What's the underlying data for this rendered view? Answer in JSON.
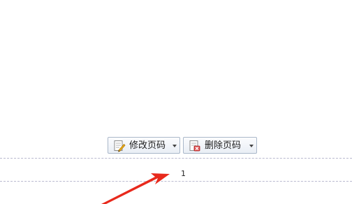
{
  "toolbar": {
    "edit_label": "修改页码",
    "delete_label": "删除页码"
  },
  "page": {
    "number": "1"
  },
  "colors": {
    "arrow": "#e8291c",
    "dashed_line": "#b9b9cf"
  },
  "icons": {
    "edit": "pencil-document-icon",
    "delete": "delete-document-icon"
  }
}
